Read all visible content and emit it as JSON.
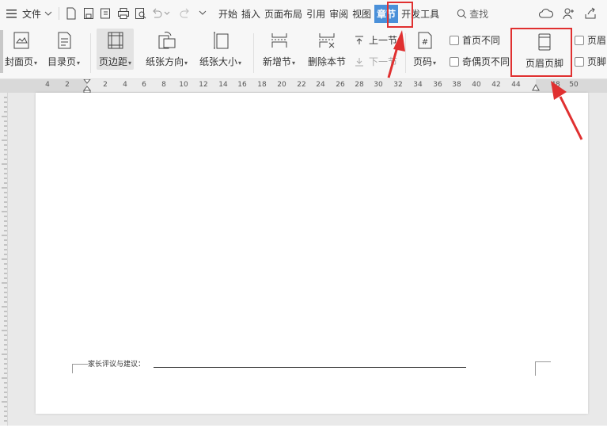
{
  "menubar": {
    "file_label": "文件",
    "tabs": [
      "开始",
      "插入",
      "页面布局",
      "引用",
      "审阅",
      "视图",
      "章节",
      "开发工具"
    ],
    "active_tab": "章节",
    "search_label": "查找"
  },
  "ribbon": {
    "cover_page": "封面页",
    "toc_page": "目录页",
    "margins": "页边距",
    "orientation": "纸张方向",
    "paper_size": "纸张大小",
    "new_section": "新增节",
    "delete_section": "删除本节",
    "prev_section": "上一节",
    "next_section": "下一节",
    "page_number": "页码",
    "first_page_diff": "首页不同",
    "odd_even_diff": "奇偶页不同",
    "header_footer": "页眉页脚",
    "header_right_1": "页眉",
    "header_right_2": "页脚"
  },
  "ruler": {
    "ticks": [
      "4",
      "2",
      "2",
      "4",
      "6",
      "8",
      "10",
      "12",
      "14",
      "16",
      "18",
      "20",
      "22",
      "24",
      "26",
      "28",
      "30",
      "32",
      "34",
      "36",
      "38",
      "40",
      "42",
      "44",
      "48",
      "50"
    ]
  },
  "document": {
    "footer_line_text": "家长评议与建议："
  },
  "colors": {
    "accent": "#4a90d9",
    "highlight": "#e03030"
  }
}
